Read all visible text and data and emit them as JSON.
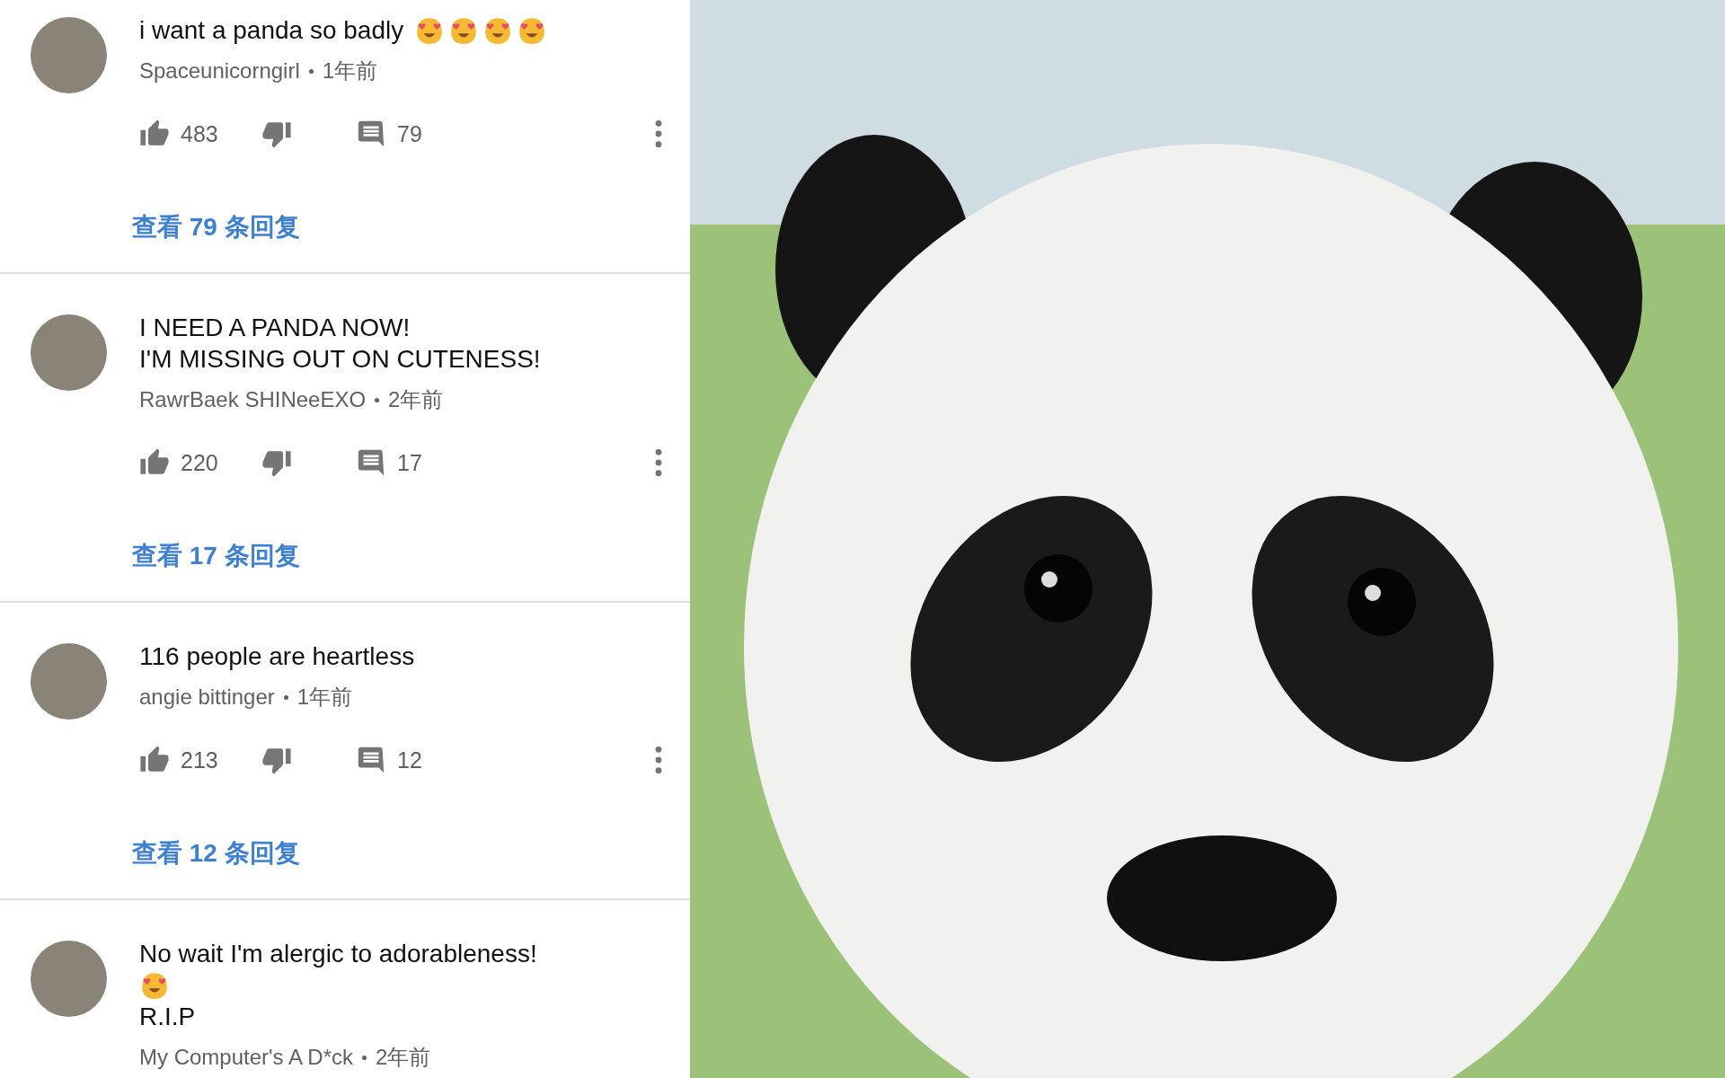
{
  "comments": [
    {
      "body": [
        [
          {
            "kind": "text",
            "text": "i want a panda so badly"
          },
          {
            "kind": "emoji"
          },
          {
            "kind": "emoji"
          },
          {
            "kind": "emoji"
          },
          {
            "kind": "emoji"
          }
        ]
      ],
      "author": "Spaceunicorngirl",
      "time": "1年前",
      "likes": "483",
      "replies": "79",
      "reply_link": "查看 79 条回复"
    },
    {
      "body": [
        [
          {
            "kind": "text",
            "text": "I NEED A PANDA NOW!"
          }
        ],
        [
          {
            "kind": "text",
            "text": "I'M MISSING OUT ON CUTENESS!"
          }
        ]
      ],
      "author": "RawrBaek SHINeeEXO",
      "time": "2年前",
      "likes": "220",
      "replies": "17",
      "reply_link": "查看 17 条回复"
    },
    {
      "body": [
        [
          {
            "kind": "text",
            "text": "116 people are heartless"
          }
        ]
      ],
      "author": "angie bittinger",
      "time": "1年前",
      "likes": "213",
      "replies": "12",
      "reply_link": "查看 12 条回复"
    },
    {
      "body": [
        [
          {
            "kind": "text",
            "text": "No wait I'm alergic to adorableness!"
          }
        ],
        [
          {
            "kind": "emoji"
          }
        ],
        [
          {
            "kind": "text",
            "text": "R.I.P"
          }
        ]
      ],
      "author": "My Computer's A D*ck",
      "time": "2年前"
    }
  ]
}
